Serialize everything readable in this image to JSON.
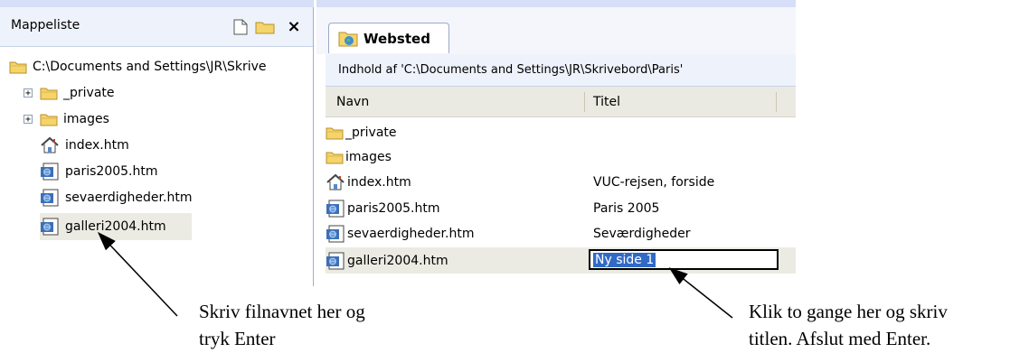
{
  "folder_pane": {
    "title": "Mappeliste",
    "root_path": "C:\\Documents and Settings\\JR\\Skrive",
    "items": [
      {
        "label": "_private",
        "icon": "folder-icon",
        "expandable": true
      },
      {
        "label": "images",
        "icon": "folder-icon",
        "expandable": true
      },
      {
        "label": "index.htm",
        "icon": "home-page-icon",
        "expandable": false
      },
      {
        "label": "paris2005.htm",
        "icon": "web-page-icon",
        "expandable": false
      },
      {
        "label": "sevaerdigheder.htm",
        "icon": "web-page-icon",
        "expandable": false
      },
      {
        "label": "galleri2004.htm",
        "icon": "web-page-icon",
        "expandable": false,
        "selected": true
      }
    ]
  },
  "web_pane": {
    "tab_label": "Websted",
    "path_text": "Indhold af 'C:\\Documents and Settings\\JR\\Skrivebord\\Paris'",
    "columns": {
      "name": "Navn",
      "title": "Titel"
    },
    "rows": [
      {
        "name": "_private",
        "title": "",
        "icon": "folder-icon"
      },
      {
        "name": "images",
        "title": "",
        "icon": "folder-icon"
      },
      {
        "name": "index.htm",
        "title": "VUC-rejsen, forside",
        "icon": "home-page-icon"
      },
      {
        "name": "paris2005.htm",
        "title": "Paris 2005",
        "icon": "web-page-icon"
      },
      {
        "name": "sevaerdigheder.htm",
        "title": "Seværdigheder",
        "icon": "web-page-icon"
      },
      {
        "name": "galleri2004.htm",
        "title": "Ny side 1",
        "icon": "web-page-icon",
        "editing": true
      }
    ]
  },
  "annotations": {
    "left_line1": "Skriv filnavnet her og",
    "left_line2": "tryk Enter",
    "right_line1": "Klik to gange her og skriv",
    "right_line2": "titlen. Afslut med Enter."
  },
  "colors": {
    "selection": "#316ac5",
    "pane_header": "#eef2fb",
    "folder": "#f2c94c"
  }
}
